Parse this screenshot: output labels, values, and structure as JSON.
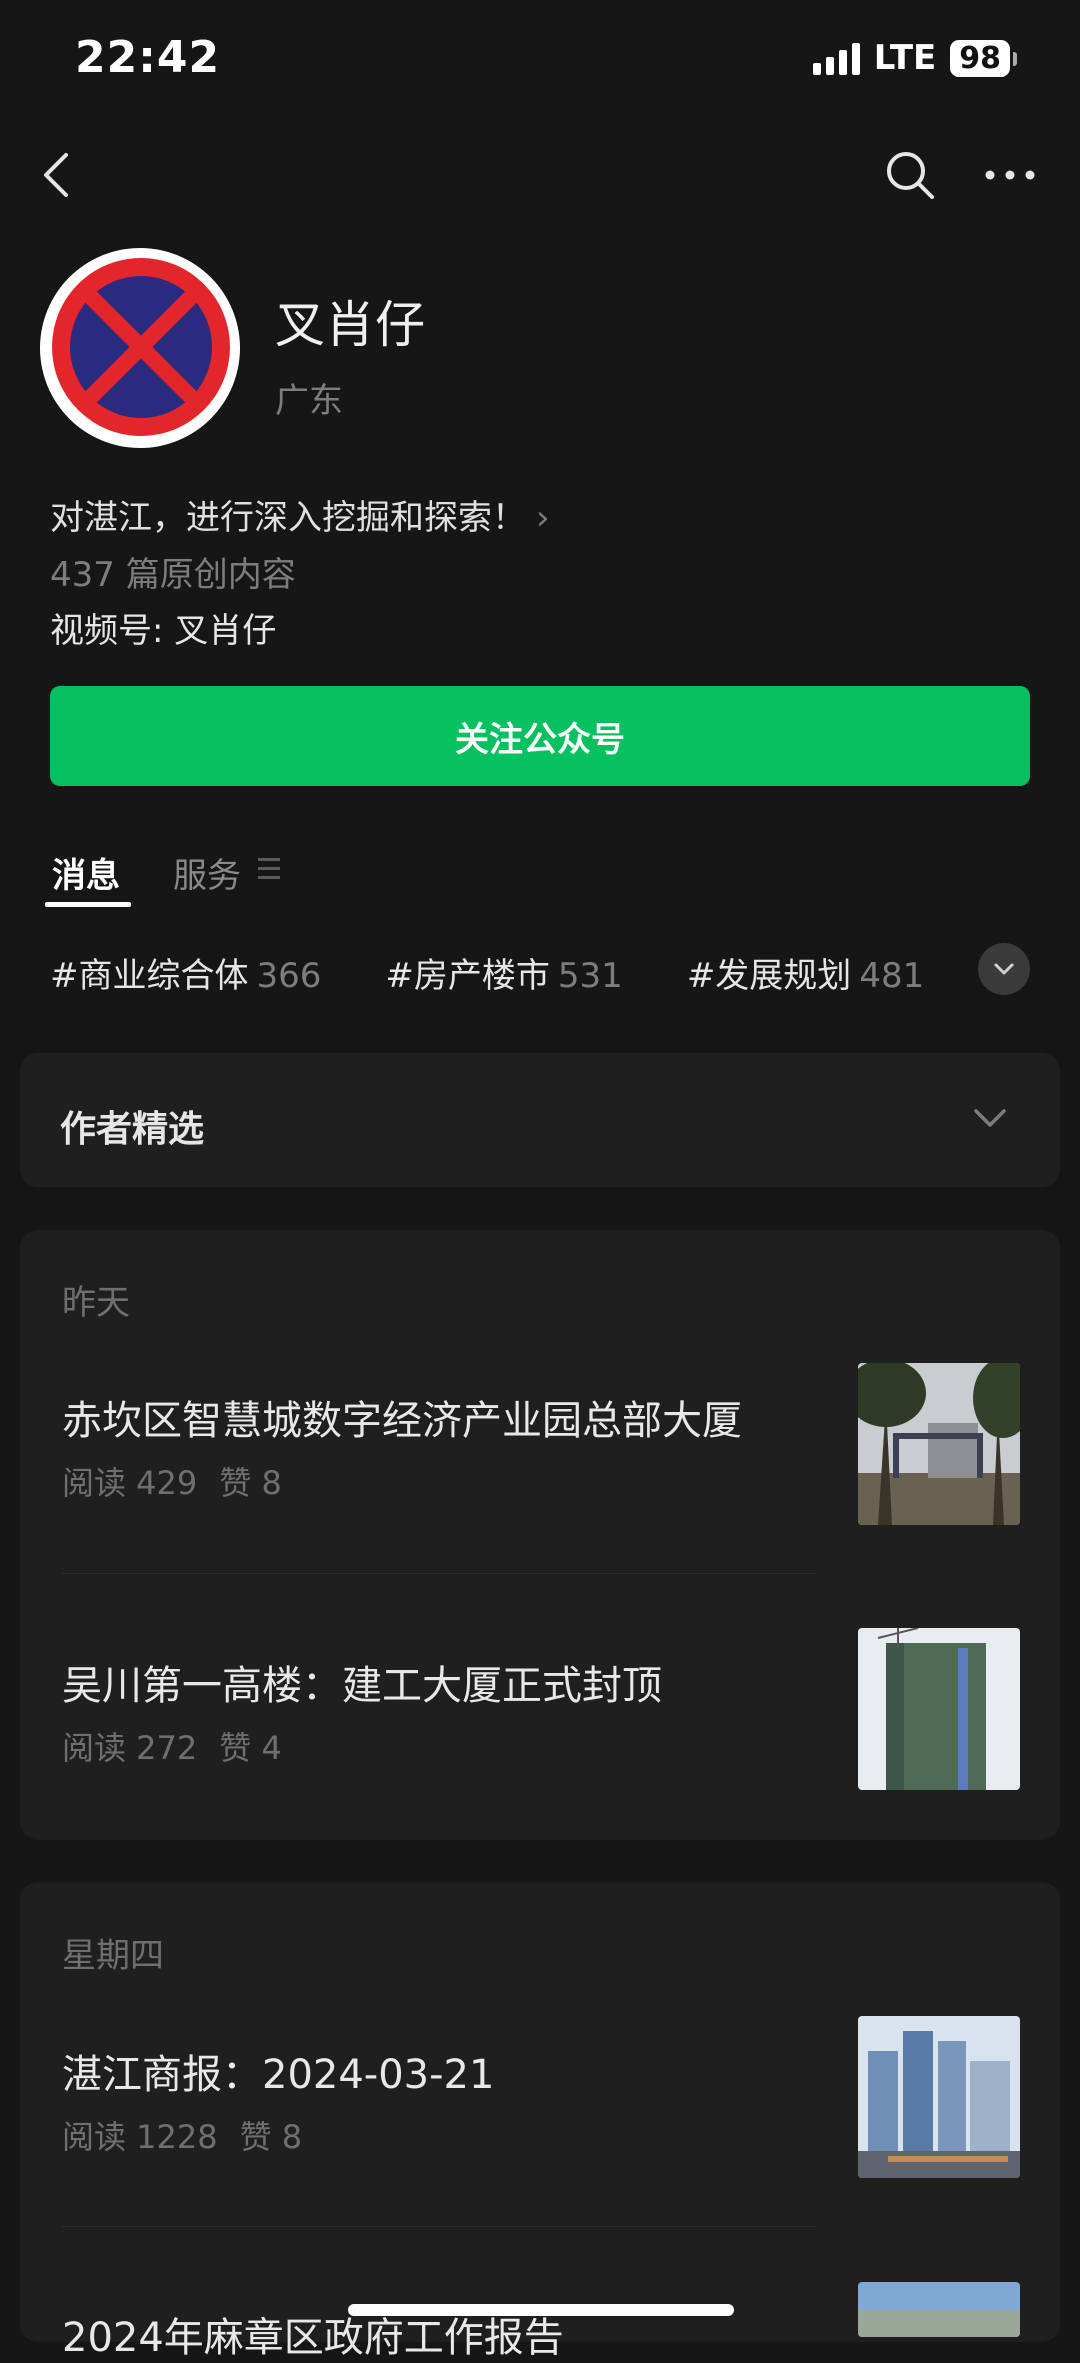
{
  "status": {
    "time": "22:42",
    "network": "LTE",
    "battery": "98"
  },
  "nav": {
    "back_icon": "chevron-left-icon",
    "search_icon": "search-icon",
    "more_icon": "more-icon"
  },
  "profile": {
    "name": "叉肖仔",
    "region": "广东",
    "bio": "对湛江，进行深入挖掘和探索！",
    "original_count": "437 篇原创内容",
    "channel": "视频号: 叉肖仔",
    "follow_label": "关注公众号"
  },
  "tabs": {
    "messages": "消息",
    "services": "服务"
  },
  "tags": [
    {
      "name": "#商业综合体",
      "count": "366"
    },
    {
      "name": "#房产楼市",
      "count": "531"
    },
    {
      "name": "#发展规划",
      "count": "481"
    }
  ],
  "picks": {
    "title": "作者精选"
  },
  "groups": [
    {
      "label": "昨天",
      "articles": [
        {
          "title": "赤坎区智慧城数字经济产业园总部大厦",
          "reads": "阅读 429",
          "likes": "赞 8"
        },
        {
          "title": "吴川第一高楼：建工大厦正式封顶",
          "reads": "阅读 272",
          "likes": "赞 4"
        }
      ]
    },
    {
      "label": "星期四",
      "articles": [
        {
          "title": "湛江商报：2024-03-21",
          "reads": "阅读 1228",
          "likes": "赞 8"
        },
        {
          "title": "2024年麻章区政府工作报告",
          "reads": "",
          "likes": ""
        }
      ]
    }
  ],
  "colors": {
    "accent_green": "#07c160",
    "background": "#161616",
    "card": "#1f1f1f"
  }
}
